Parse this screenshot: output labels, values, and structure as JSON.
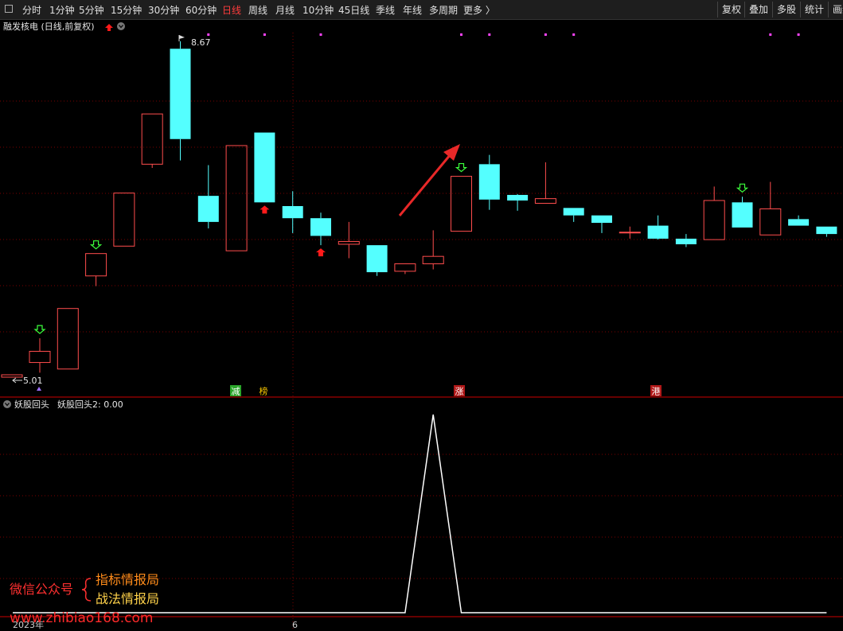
{
  "toolbar": {
    "periods": [
      {
        "label": "分时",
        "active": false
      },
      {
        "label": "1分钟",
        "active": false
      },
      {
        "label": "5分钟",
        "active": false
      },
      {
        "label": "15分钟",
        "active": false
      },
      {
        "label": "30分钟",
        "active": false
      },
      {
        "label": "60分钟",
        "active": false
      },
      {
        "label": "日线",
        "active": true
      },
      {
        "label": "周线",
        "active": false
      },
      {
        "label": "月线",
        "active": false
      },
      {
        "label": "10分钟",
        "active": false
      },
      {
        "label": "45日线",
        "active": false
      },
      {
        "label": "季线",
        "active": false
      },
      {
        "label": "年线",
        "active": false
      },
      {
        "label": "多周期",
        "active": false
      },
      {
        "label": "更多 〉",
        "active": false
      }
    ],
    "right_buttons": [
      "复权",
      "叠加",
      "多股",
      "统计",
      "画线"
    ]
  },
  "main_panel": {
    "title": "融发核电 (日线,前复权)",
    "high_label": "8.67",
    "low_label": "5.01"
  },
  "sub_panel": {
    "title_name": "妖股回头",
    "title_value": "妖股回头2: 0.00"
  },
  "xaxis": {
    "year_label": "2023年",
    "month_label": "6"
  },
  "badges": [
    {
      "text": "减",
      "color": "#2aa52a",
      "fg": "#ffffff"
    },
    {
      "text": "榜",
      "color": "#000000",
      "fg": "#ffcc00"
    },
    {
      "text": "涨",
      "color": "#b01818",
      "fg": "#ffffff"
    },
    {
      "text": "港",
      "color": "#b01818",
      "fg": "#ffffff"
    }
  ],
  "watermark": {
    "account_label": "微信公众号",
    "line1": "指标情报局",
    "line2": "战法情报局",
    "url": "www.zhibiao168.com"
  },
  "colors": {
    "up": "#ff4d4d",
    "down": "#54ffff",
    "grid": "#7a0000",
    "indicator": "#ffffff",
    "buy_arrow": "#3cff3c",
    "sell_arrow": "#ff1a1a",
    "marker": "#ff44ff"
  },
  "chart_data": {
    "type": "candlestick",
    "price_range": [
      4.9,
      8.9
    ],
    "candles": [
      {
        "open": 5.22,
        "close": 5.34,
        "high": 5.48,
        "low": 5.11
      },
      {
        "open": 5.15,
        "close": 5.8,
        "high": 5.8,
        "low": 5.15
      },
      {
        "open": 6.15,
        "close": 6.39,
        "high": 6.39,
        "low": 6.04
      },
      {
        "open": 6.47,
        "close": 7.04,
        "high": 7.04,
        "low": 6.47
      },
      {
        "open": 7.35,
        "close": 7.89,
        "high": 7.89,
        "low": 7.31
      },
      {
        "open": 8.59,
        "close": 7.62,
        "high": 8.67,
        "low": 7.39
      },
      {
        "open": 7.01,
        "close": 6.73,
        "high": 7.34,
        "low": 6.66
      },
      {
        "open": 6.42,
        "close": 7.55,
        "high": 7.55,
        "low": 6.42
      },
      {
        "open": 7.69,
        "close": 6.94,
        "high": 7.69,
        "low": 6.94
      },
      {
        "open": 6.9,
        "close": 6.77,
        "high": 7.06,
        "low": 6.61
      },
      {
        "open": 6.77,
        "close": 6.58,
        "high": 6.83,
        "low": 6.48
      },
      {
        "open": 6.49,
        "close": 6.52,
        "high": 6.73,
        "low": 6.34
      },
      {
        "open": 6.48,
        "close": 6.19,
        "high": 6.48,
        "low": 6.15
      },
      {
        "open": 6.2,
        "close": 6.28,
        "high": 6.28,
        "low": 6.17
      },
      {
        "open": 6.28,
        "close": 6.36,
        "high": 6.64,
        "low": 6.22
      },
      {
        "open": 6.63,
        "close": 7.22,
        "high": 7.22,
        "low": 6.63
      },
      {
        "open": 7.35,
        "close": 6.97,
        "high": 7.45,
        "low": 6.86
      },
      {
        "open": 7.02,
        "close": 6.96,
        "high": 7.03,
        "low": 6.85
      },
      {
        "open": 6.93,
        "close": 6.98,
        "high": 7.37,
        "low": 6.93
      },
      {
        "open": 6.88,
        "close": 6.8,
        "high": 6.88,
        "low": 6.73
      },
      {
        "open": 6.8,
        "close": 6.72,
        "high": 6.8,
        "low": 6.61
      },
      {
        "open": 6.62,
        "close": 6.62,
        "high": 6.68,
        "low": 6.55
      },
      {
        "open": 6.69,
        "close": 6.55,
        "high": 6.8,
        "low": 6.54
      },
      {
        "open": 6.55,
        "close": 6.49,
        "high": 6.6,
        "low": 6.46
      },
      {
        "open": 6.54,
        "close": 6.96,
        "high": 7.11,
        "low": 6.54
      },
      {
        "open": 6.94,
        "close": 6.67,
        "high": 7.0,
        "low": 6.67
      },
      {
        "open": 6.59,
        "close": 6.87,
        "high": 7.16,
        "low": 6.59
      },
      {
        "open": 6.76,
        "close": 6.69,
        "high": 6.8,
        "low": 6.69
      },
      {
        "open": 6.68,
        "close": 6.6,
        "high": 6.68,
        "low": 6.57
      }
    ],
    "indicator": {
      "name": "妖股回头2",
      "range": [
        0,
        1
      ],
      "values": [
        0,
        0,
        0,
        0,
        0,
        0,
        0,
        0,
        0,
        0,
        0,
        0,
        0,
        0,
        1,
        0,
        0,
        0,
        0,
        0,
        0,
        0,
        0,
        0,
        0,
        0,
        0,
        0,
        0
      ]
    },
    "buy_signals": [
      0,
      2,
      15,
      25
    ],
    "sell_signals": [
      8,
      10
    ],
    "top_markers": [
      6,
      8,
      10,
      15,
      16,
      18,
      19,
      26,
      27,
      29
    ]
  }
}
